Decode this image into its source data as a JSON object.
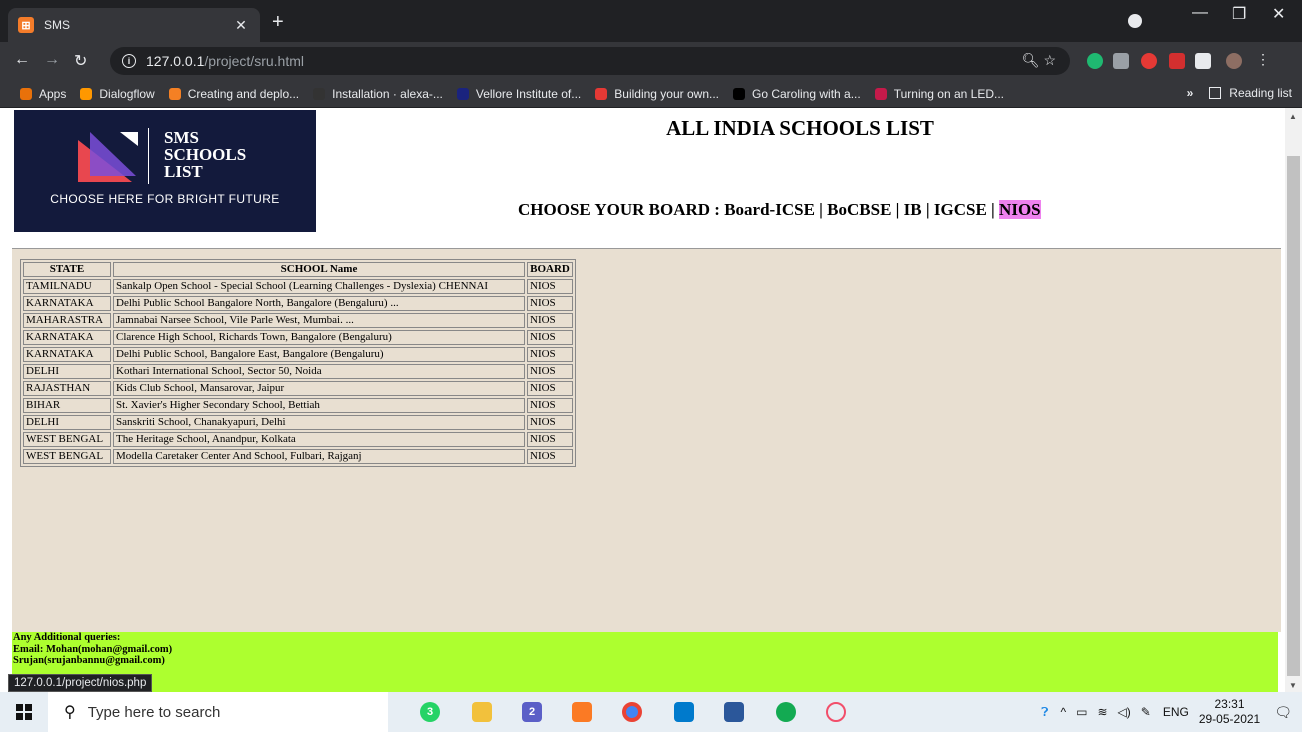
{
  "browser": {
    "tab_title": "SMS",
    "tab_icon_glyph": "⊞",
    "url_host": "127.0.0.1",
    "url_path": "/project/sru.html",
    "bookmarks": [
      {
        "label": "Apps",
        "icon": "apps-grid-icon",
        "color": "#e8710a"
      },
      {
        "label": "Dialogflow",
        "icon": "dialogflow-icon",
        "color": "#ff9800"
      },
      {
        "label": "Creating and deplo...",
        "icon": "stackoverflow-icon",
        "color": "#f48024"
      },
      {
        "label": "Installation · alexa-...",
        "icon": "github-icon",
        "color": "#333333"
      },
      {
        "label": "Vellore Institute of...",
        "icon": "vit-icon",
        "color": "#1a237e"
      },
      {
        "label": "Building your own...",
        "icon": "upwork-icon",
        "color": "#e53935"
      },
      {
        "label": "Go Caroling with a...",
        "icon": "medium-icon",
        "color": "#000000"
      },
      {
        "label": "Turning on an LED...",
        "icon": "raspberry-icon",
        "color": "#c51a4a"
      }
    ],
    "more_bookmarks": "»",
    "reading_list": "Reading list"
  },
  "page": {
    "logo": {
      "line1": "SMS",
      "line2": "SCHOOLS",
      "line3": "LIST",
      "tagline": "CHOOSE HERE FOR BRIGHT FUTURE"
    },
    "title": "ALL INDIA SCHOOLS LIST",
    "board_prefix": "CHOOSE YOUR BOARD : ",
    "board_links": [
      "Board-ICSE",
      "BoCBSE",
      "IB",
      "IGCSE",
      "NIOS"
    ],
    "table": {
      "headers": [
        "STATE",
        "SCHOOL Name",
        "BOARD"
      ],
      "rows": [
        [
          "TAMILNADU",
          "Sankalp Open School - Special School (Learning Challenges - Dyslexia) CHENNAI",
          "NIOS"
        ],
        [
          "KARNATAKA",
          "Delhi Public School Bangalore North, Bangalore (Bengaluru) ...",
          "NIOS"
        ],
        [
          "MAHARASTRA",
          "Jamnabai Narsee School, Vile Parle West, Mumbai. ...",
          "NIOS"
        ],
        [
          "KARNATAKA",
          "Clarence High School, Richards Town, Bangalore (Bengaluru)",
          "NIOS"
        ],
        [
          "KARNATAKA",
          "Delhi Public School, Bangalore East, Bangalore (Bengaluru)",
          "NIOS"
        ],
        [
          "DELHI",
          "Kothari International School, Sector 50, Noida",
          "NIOS"
        ],
        [
          "RAJASTHAN",
          "Kids Club School, Mansarovar, Jaipur",
          "NIOS"
        ],
        [
          "BIHAR",
          "St. Xavier's Higher Secondary School, Bettiah",
          "NIOS"
        ],
        [
          "DELHI",
          "Sanskriti School, Chanakyapuri, Delhi",
          "NIOS"
        ],
        [
          "WEST BENGAL",
          "The Heritage School, Anandpur, Kolkata",
          "NIOS"
        ],
        [
          "WEST BENGAL",
          "Modella Caretaker Center And School, Fulbari, Rajganj",
          "NIOS"
        ]
      ]
    },
    "footer": {
      "line1": "Any Additional queries:",
      "line2": "Email: Mohan(mohan@gmail.com)",
      "line3": "Srujan(srujanbannu@gmail.com)"
    },
    "status_url": "127.0.0.1/project/nios.php"
  },
  "taskbar": {
    "search_placeholder": "Type here to search",
    "language": "ENG",
    "time": "23:31",
    "date": "29-05-2021",
    "whatsapp_badge": "3",
    "teams_badge": "2"
  },
  "colors": {
    "content_bg": "#e8dfd1",
    "footer_bg": "#adff2f",
    "nios_highlight": "#ee82ee",
    "logo_bg": "#131a3c"
  }
}
